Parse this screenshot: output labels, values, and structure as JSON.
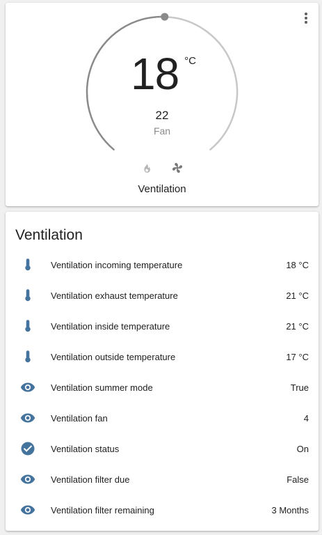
{
  "thermostat": {
    "current_temp": "18",
    "unit": "°C",
    "target_temp": "22",
    "mode": "Fan",
    "name": "Ventilation",
    "colors": {
      "arc_active": "#8a8a8a",
      "arc_inactive": "#c8c8c8",
      "icon_inactive": "#9e9e9e",
      "icon_active": "#6f6f6f"
    },
    "icons": [
      "fire-icon",
      "fan-icon"
    ]
  },
  "entities": {
    "title": "Ventilation",
    "icon_color": "#44739e",
    "rows": [
      {
        "icon": "thermometer-icon",
        "name": "Ventilation incoming temperature",
        "state": "18 °C"
      },
      {
        "icon": "thermometer-icon",
        "name": "Ventilation exhaust temperature",
        "state": "21 °C"
      },
      {
        "icon": "thermometer-icon",
        "name": "Ventilation inside temperature",
        "state": "21 °C"
      },
      {
        "icon": "thermometer-icon",
        "name": "Ventilation outside temperature",
        "state": "17 °C"
      },
      {
        "icon": "eye-icon",
        "name": "Ventilation summer mode",
        "state": "True"
      },
      {
        "icon": "eye-icon",
        "name": "Ventilation fan",
        "state": "4"
      },
      {
        "icon": "check-circle-icon",
        "name": "Ventilation status",
        "state": "On"
      },
      {
        "icon": "eye-icon",
        "name": "Ventilation filter due",
        "state": "False"
      },
      {
        "icon": "eye-icon",
        "name": "Ventilation filter remaining",
        "state": "3 Months"
      }
    ]
  }
}
